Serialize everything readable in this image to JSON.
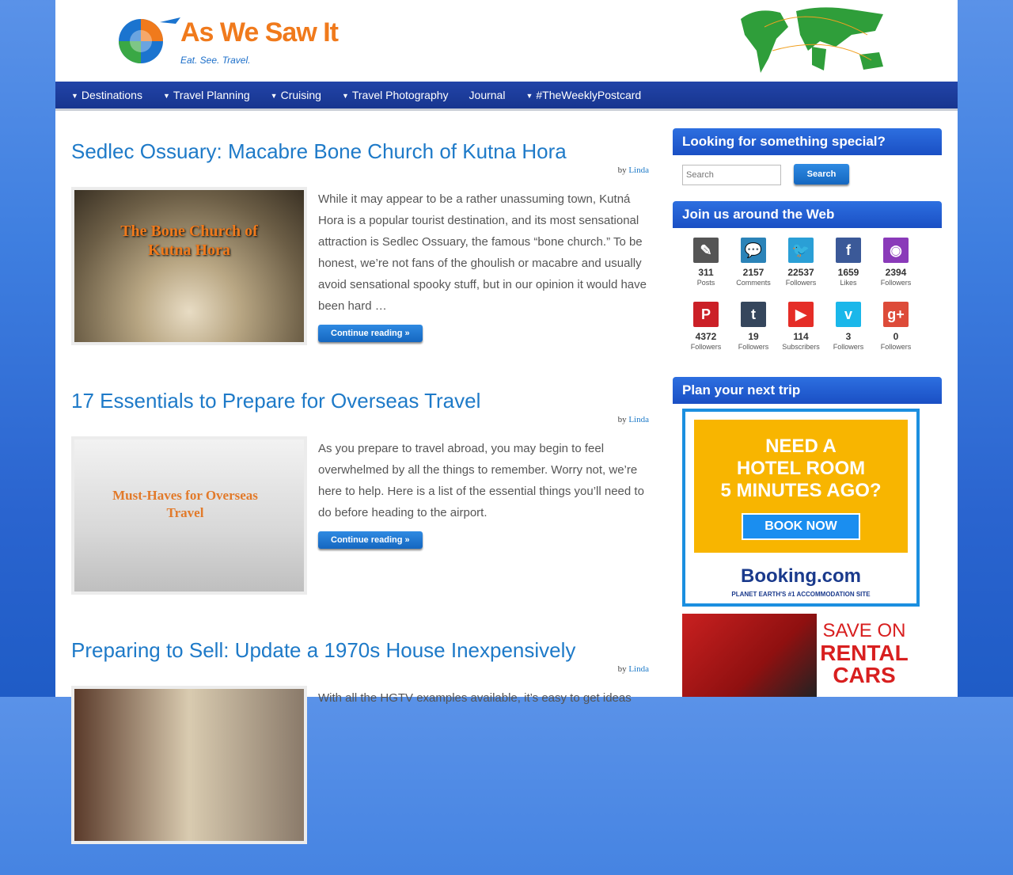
{
  "site": {
    "name": "As We Saw It",
    "tagline": "Eat. See. Travel."
  },
  "nav": [
    {
      "label": "Destinations",
      "dropdown": true
    },
    {
      "label": "Travel Planning",
      "dropdown": true
    },
    {
      "label": "Cruising",
      "dropdown": true
    },
    {
      "label": "Travel Photography",
      "dropdown": true
    },
    {
      "label": "Journal",
      "dropdown": false
    },
    {
      "label": "#TheWeeklyPostcard",
      "dropdown": true
    }
  ],
  "posts": [
    {
      "title": "Sedlec Ossuary: Macabre Bone Church of Kutna Hora",
      "by": "by",
      "author": "Linda",
      "thumb_text": "The Bone Church of Kutna Hora",
      "excerpt": "While it may appear to be a rather unassuming town, Kutná Hora is a popular tourist destination, and its most sensational attraction is Sedlec Ossuary, the famous “bone church.” To be honest, we’re not fans of the ghoulish or macabre and usually avoid sensational spooky stuff, but in our opinion it would have been hard …",
      "more": "Continue reading »"
    },
    {
      "title": "17 Essentials to Prepare for Overseas Travel",
      "by": "by",
      "author": "Linda",
      "thumb_text": "Must-Haves for Overseas Travel",
      "excerpt": "As you prepare to travel abroad, you may begin to feel overwhelmed by all the things to remember. Worry not, we’re here to help. Here is a list of the essential things you’ll need to do before heading to the airport.",
      "more": "Continue reading »"
    },
    {
      "title": "Preparing to Sell: Update a 1970s House Inexpensively",
      "by": "by",
      "author": "Linda",
      "excerpt": "With all the HGTV examples available, it’s easy to get ideas"
    }
  ],
  "sidebar": {
    "search": {
      "title": "Looking for something special?",
      "placeholder": "Search",
      "button": "Search"
    },
    "social": {
      "title": "Join us around the Web",
      "items": [
        {
          "icon": "pencil-icon",
          "glyph": "✎",
          "color": "#555555",
          "count": "311",
          "label": "Posts"
        },
        {
          "icon": "comment-icon",
          "glyph": "💬",
          "color": "#2b83b8",
          "count": "2157",
          "label": "Comments"
        },
        {
          "icon": "twitter-icon",
          "glyph": "🐦",
          "color": "#2a9fd6",
          "count": "22537",
          "label": "Followers"
        },
        {
          "icon": "facebook-icon",
          "glyph": "f",
          "color": "#3b5998",
          "count": "1659",
          "label": "Likes"
        },
        {
          "icon": "instagram-icon",
          "glyph": "◉",
          "color": "#8a3ab9",
          "count": "2394",
          "label": "Followers"
        },
        {
          "icon": "pinterest-icon",
          "glyph": "P",
          "color": "#cb2027",
          "count": "4372",
          "label": "Followers"
        },
        {
          "icon": "tumblr-icon",
          "glyph": "t",
          "color": "#35465c",
          "count": "19",
          "label": "Followers"
        },
        {
          "icon": "youtube-icon",
          "glyph": "▶",
          "color": "#e52d27",
          "count": "114",
          "label": "Subscribers"
        },
        {
          "icon": "vimeo-icon",
          "glyph": "v",
          "color": "#1ab7ea",
          "count": "3",
          "label": "Followers"
        },
        {
          "icon": "google-plus-icon",
          "glyph": "g+",
          "color": "#dd4b39",
          "count": "0",
          "label": "Followers"
        }
      ]
    },
    "plan": {
      "title": "Plan your next trip",
      "ad1_headline": [
        "NEED A",
        "HOTEL ROOM",
        "5 MINUTES AGO?"
      ],
      "ad1_button": "BOOK NOW",
      "ad1_brand": "Booking.com",
      "ad1_sub": "PLANET EARTH'S #1 ACCOMMODATION SITE",
      "ad2_line1": "SAVE ON",
      "ad2_line2": "RENTAL",
      "ad2_line3": "CARS"
    }
  }
}
